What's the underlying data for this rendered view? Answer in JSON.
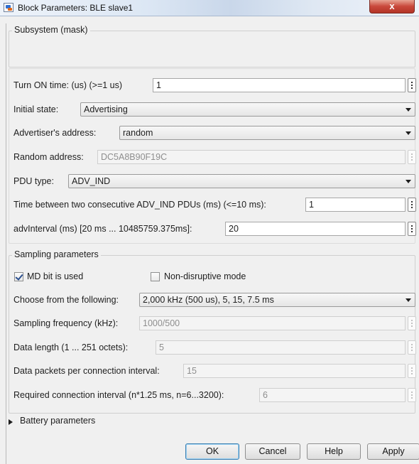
{
  "window": {
    "title": "Block Parameters: BLE slave1",
    "close_symbol": "x"
  },
  "mask": {
    "title": "Subsystem (mask)"
  },
  "params": {
    "turn_on_label": "Turn ON time: (us) (>=1 us)",
    "turn_on_value": "1",
    "initial_state_label": "Initial state:",
    "initial_state_value": "Advertising",
    "adv_address_label": "Advertiser's address:",
    "adv_address_value": "random",
    "random_address_label": "Random address:",
    "random_address_value": "DC5A8B90F19C",
    "pdu_type_label": "PDU type:",
    "pdu_type_value": "ADV_IND",
    "time_between_label": "Time between two consecutive ADV_IND PDUs (ms) (<=10 ms):",
    "time_between_value": "1",
    "adv_interval_label": "advInterval (ms) [20 ms ... 10485759.375ms]:",
    "adv_interval_value": "20"
  },
  "sampling": {
    "title": "Sampling parameters",
    "md_bit_label": "MD bit is used",
    "md_bit_checked": true,
    "non_disruptive_label": "Non-disruptive mode",
    "non_disruptive_checked": false,
    "choose_label": "Choose from the following:",
    "choose_value": "2,000 kHz (500 us), 5, 15, 7.5 ms",
    "freq_label": "Sampling frequency (kHz):",
    "freq_value": "1000/500",
    "data_length_label": "Data length (1 ... 251 octets):",
    "data_length_value": "5",
    "packets_label": "Data packets per connection interval:",
    "packets_value": "15",
    "conn_interval_label": "Required connection interval (n*1.25 ms, n=6...3200):",
    "conn_interval_value": "6"
  },
  "battery": {
    "label": "Battery parameters",
    "expanded": false
  },
  "buttons": {
    "ok": "OK",
    "cancel": "Cancel",
    "help": "Help",
    "apply": "Apply"
  }
}
